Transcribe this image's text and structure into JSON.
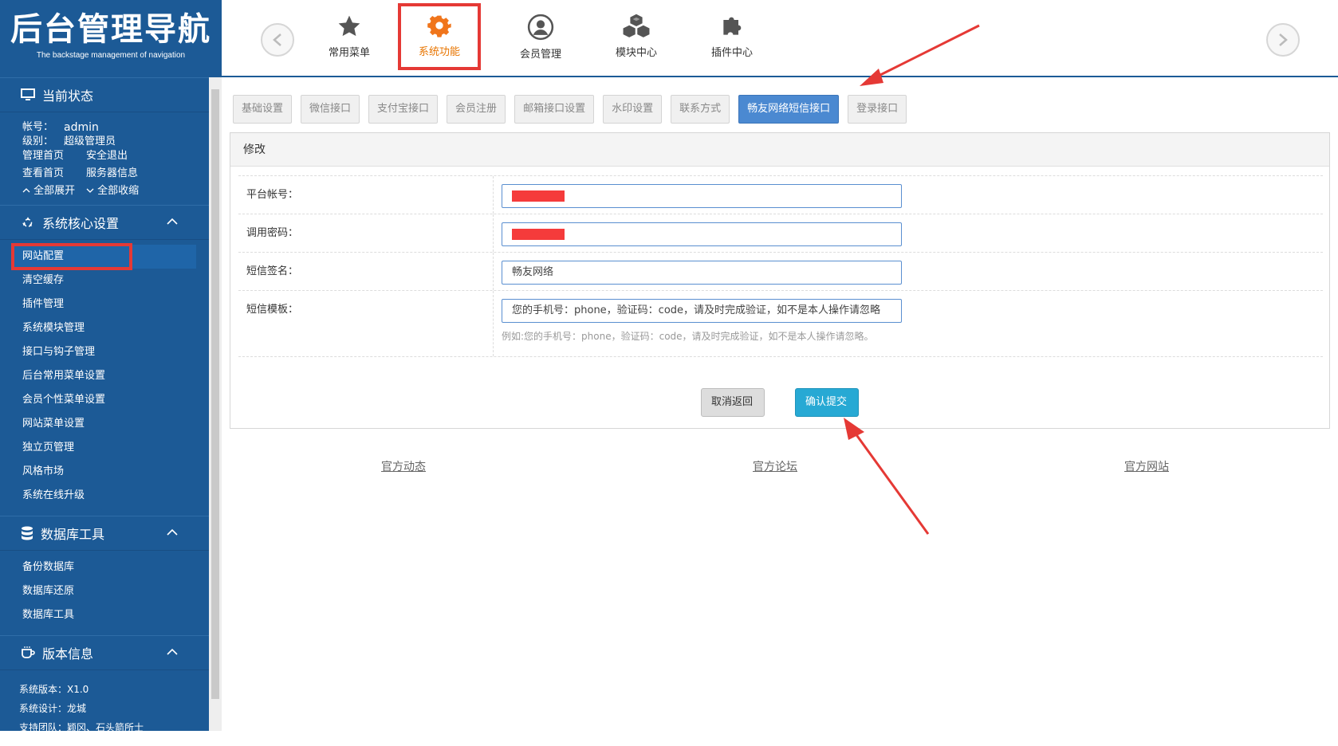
{
  "header": {
    "logo_title": "后台管理导航",
    "logo_subtitle": "The backstage management of navigation",
    "menu": [
      {
        "label": "常用菜单",
        "icon": "star-icon"
      },
      {
        "label": "系统功能",
        "icon": "gear-icon",
        "active": true
      },
      {
        "label": "会员管理",
        "icon": "user-icon"
      },
      {
        "label": "模块中心",
        "icon": "cubes-icon"
      },
      {
        "label": "插件中心",
        "icon": "puzzle-icon"
      }
    ]
  },
  "sidebar": {
    "status": {
      "title": "当前状态",
      "account_label": "帐号：",
      "account_value": "admin",
      "level_label": "级别：",
      "level_value": "超级管理员",
      "link_home": "管理首页",
      "link_logout": "安全退出",
      "link_view": "查看首页",
      "link_server": "服务器信息",
      "expand_all": "全部展开",
      "collapse_all": "全部收缩"
    },
    "core": {
      "title": "系统核心设置",
      "items": [
        "网站配置",
        "清空缓存",
        "插件管理",
        "系统模块管理",
        "接口与钩子管理",
        "后台常用菜单设置",
        "会员个性菜单设置",
        "网站菜单设置",
        "独立页管理",
        "风格市场",
        "系统在线升级"
      ]
    },
    "db": {
      "title": "数据库工具",
      "items": [
        "备份数据库",
        "数据库还原",
        "数据库工具"
      ]
    },
    "version": {
      "title": "版本信息",
      "line1": "系统版本：X1.0",
      "line2": "系统设计：龙城",
      "line3": "支持团队：颖冈、石头箭所士"
    }
  },
  "tabs": [
    "基础设置",
    "微信接口",
    "支付宝接口",
    "会员注册",
    "邮箱接口设置",
    "水印设置",
    "联系方式",
    "畅友网络短信接口",
    "登录接口"
  ],
  "panel": {
    "title": "修改",
    "fields": [
      {
        "label": "平台帐号：",
        "value": ""
      },
      {
        "label": "调用密码：",
        "value": ""
      },
      {
        "label": "短信签名：",
        "value": "畅友网络"
      },
      {
        "label": "短信模板：",
        "value": "您的手机号：phone，验证码：code，请及时完成验证，如不是本人操作请忽略",
        "hint": "例如:您的手机号：phone，验证码：code，请及时完成验证，如不是本人操作请忽略。"
      }
    ],
    "cancel_label": "取消返回",
    "submit_label": "确认提交"
  },
  "footer_links": [
    "官方动态",
    "官方论坛",
    "官方网站"
  ],
  "colors": {
    "sidebar_bg": "#1c5a96",
    "accent_active": "#4b89d1",
    "submit": "#27a9d4",
    "annotation": "#e53935"
  }
}
